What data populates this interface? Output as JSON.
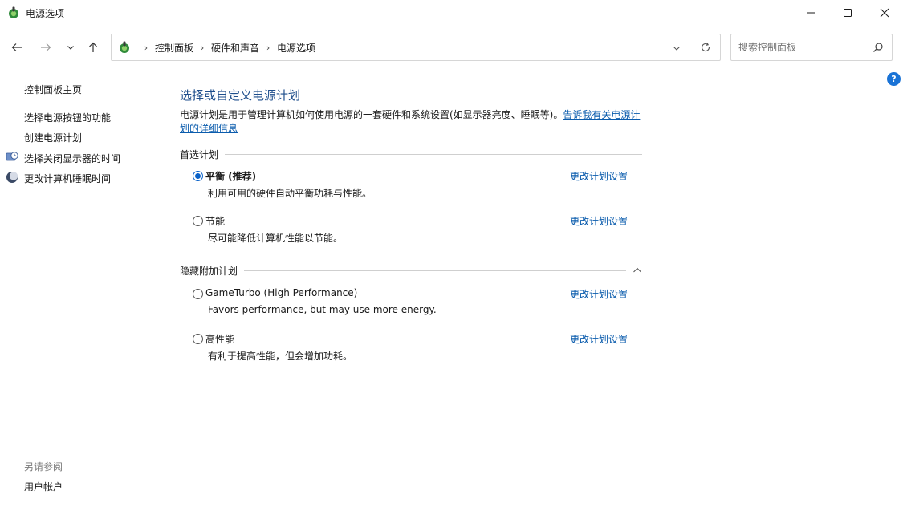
{
  "window": {
    "title": "电源选项"
  },
  "address": {
    "crumbs": [
      "控制面板",
      "硬件和声音",
      "电源选项"
    ]
  },
  "search": {
    "placeholder": "搜索控制面板"
  },
  "sidebar": {
    "home_link": "控制面板主页",
    "links": [
      "选择电源按钮的功能",
      "创建电源计划",
      "选择关闭显示器的时间",
      "更改计算机睡眠时间"
    ],
    "see_also_heading": "另请参阅",
    "see_also_links": [
      "用户帐户"
    ]
  },
  "main": {
    "title": "选择或自定义电源计划",
    "description": "电源计划是用于管理计算机如何使用电源的一套硬件和系统设置(如显示器亮度、睡眠等)。",
    "description_link": "告诉我有关电源计划的详细信息",
    "preferred_group": {
      "label": "首选计划",
      "plans": [
        {
          "name": "平衡 (推荐)",
          "description": "利用可用的硬件自动平衡功耗与性能。",
          "link": "更改计划设置",
          "selected": true
        },
        {
          "name": "节能",
          "description": "尽可能降低计算机性能以节能。",
          "link": "更改计划设置",
          "selected": false
        }
      ]
    },
    "hidden_group": {
      "label": "隐藏附加计划",
      "plans": [
        {
          "name": "GameTurbo (High Performance)",
          "description": "Favors performance, but may use more energy.",
          "link": "更改计划设置",
          "selected": false
        },
        {
          "name": "高性能",
          "description": "有利于提高性能，但会增加功耗。",
          "link": "更改计划设置",
          "selected": false
        }
      ]
    }
  },
  "colors": {
    "link": "#0b5cad",
    "title": "#1e4e8c",
    "radio_selected": "#0a62c9",
    "help_badge": "#1a73d6"
  }
}
